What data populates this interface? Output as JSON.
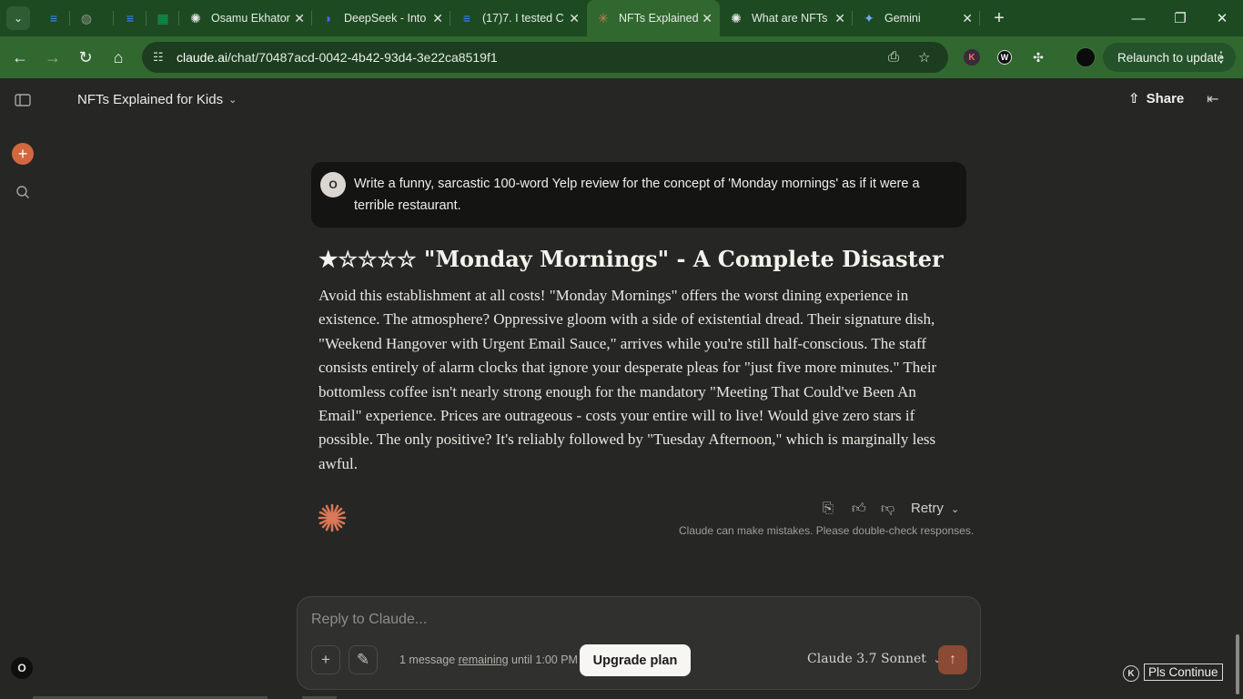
{
  "browser": {
    "tabs": [
      {
        "title": "",
        "favicon": "docs-icon",
        "color": "#4285f4"
      },
      {
        "title": "",
        "favicon": "globe-icon",
        "color": "#8a9a8a"
      },
      {
        "title": "",
        "favicon": "docs-icon",
        "color": "#4285f4"
      },
      {
        "title": "",
        "favicon": "sheets-icon",
        "color": "#0f9d58"
      },
      {
        "title": "Osamu Ekhator",
        "favicon": "openai-icon",
        "color": "#e6e6e6"
      },
      {
        "title": "DeepSeek - Into",
        "favicon": "deepseek-icon",
        "color": "#4d6bfe"
      },
      {
        "title": "(17)7. I tested C",
        "favicon": "docs-icon",
        "color": "#4285f4"
      },
      {
        "title": "NFTs Explained",
        "favicon": "claude-icon",
        "color": "#d97757"
      },
      {
        "title": "What are NFTs",
        "favicon": "openai-icon",
        "color": "#e6e6e6"
      },
      {
        "title": "Gemini",
        "favicon": "gemini-icon",
        "color": "#6ea8ff"
      }
    ],
    "url_host": "claude.ai",
    "url_path": "/chat/70487acd-0042-4b42-93d4-3e22ca8519f1",
    "relaunch_label": "Relaunch to update"
  },
  "header": {
    "chat_title": "NFTs Explained for Kids",
    "share_label": "Share"
  },
  "sidebar": {
    "avatar_initial": "O"
  },
  "conversation": {
    "user_initial": "O",
    "user_message": "Write a funny, sarcastic 100-word Yelp review for the concept of 'Monday mornings' as if it were a terrible restaurant.",
    "response_title": "★☆☆☆☆ \"Monday Mornings\" - A Complete Disaster",
    "response_body": "Avoid this establishment at all costs! \"Monday Mornings\" offers the worst dining experience in existence. The atmosphere? Oppressive gloom with a side of existential dread. Their signature dish, \"Weekend Hangover with Urgent Email Sauce,\" arrives while you're still half-conscious. The staff consists entirely of alarm clocks that ignore your desperate pleas for \"just five more minutes.\" Their bottomless coffee isn't nearly strong enough for the mandatory \"Meeting That Could've Been An Email\" experience. Prices are outrageous - costs your entire will to live! Would give zero stars if possible. The only positive? It's reliably followed by \"Tuesday Afternoon,\" which is marginally less awful.",
    "retry_label": "Retry",
    "disclaimer": "Claude can make mistakes. Please double-check responses."
  },
  "composer": {
    "placeholder": "Reply to Claude...",
    "limit_prefix": "1 message",
    "limit_link": "remaining",
    "limit_suffix": "until 1:00 PM",
    "upgrade_label": "Upgrade plan",
    "model_label": "Claude 3.7 Sonnet"
  },
  "overlay": {
    "k_badge": "K",
    "continue_label": "Pls Continue"
  },
  "colors": {
    "accent": "#d97757",
    "chrome_green": "#31682f",
    "background": "#262624"
  }
}
